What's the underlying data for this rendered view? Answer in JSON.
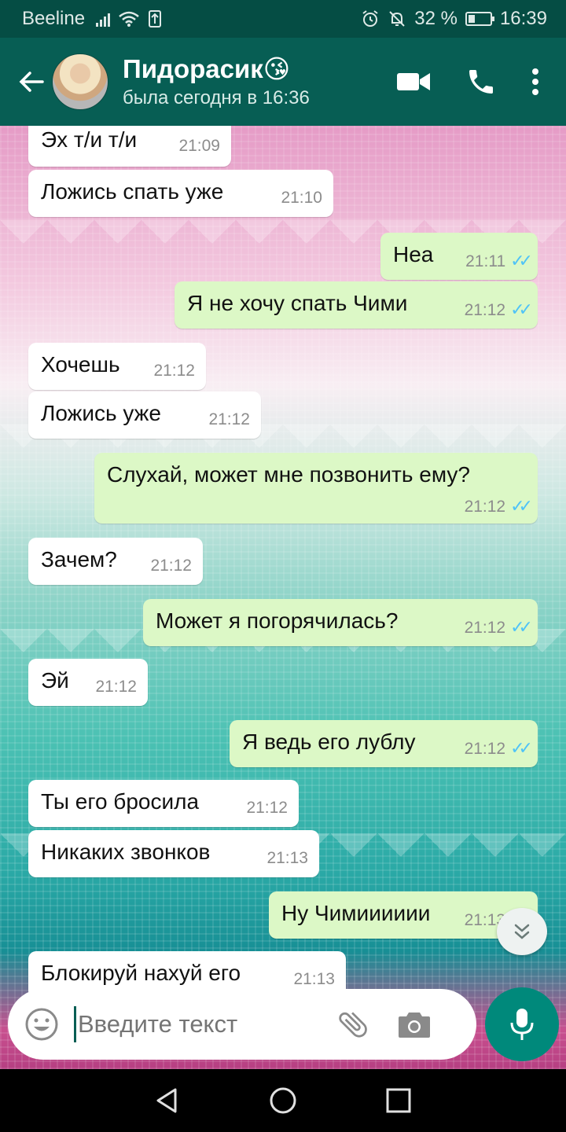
{
  "status_bar": {
    "carrier": "Beeline",
    "battery": "32 %",
    "battery_level": 0.32,
    "time": "16:39"
  },
  "header": {
    "contact_name": "Пидорасик😘",
    "last_seen": "была сегодня в 16:36",
    "icons": [
      "back-arrow-icon",
      "video-call-icon",
      "phone-icon",
      "more-vert-icon"
    ]
  },
  "messages": [
    {
      "dir": "in",
      "text": "Эх т/и т/и",
      "time": "21:09"
    },
    {
      "dir": "in",
      "text": "Ложись спать уже",
      "time": "21:10"
    },
    {
      "dir": "out",
      "text": "Неа",
      "time": "21:11"
    },
    {
      "dir": "out",
      "text": "Я не хочу спать Чими",
      "time": "21:12"
    },
    {
      "dir": "in",
      "text": "Хочешь",
      "time": "21:12"
    },
    {
      "dir": "in",
      "text": "Ложись уже",
      "time": "21:12"
    },
    {
      "dir": "out",
      "text": "Слухай, может мне позвонить ему?",
      "time": "21:12"
    },
    {
      "dir": "in",
      "text": "Зачем?",
      "time": "21:12"
    },
    {
      "dir": "out",
      "text": "Может я погорячилась?",
      "time": "21:12"
    },
    {
      "dir": "in",
      "text": "Эй",
      "time": "21:12"
    },
    {
      "dir": "out",
      "text": "Я ведь его лублу",
      "time": "21:12"
    },
    {
      "dir": "in",
      "text": "Ты его бросила",
      "time": "21:12"
    },
    {
      "dir": "in",
      "text": "Никаких звонков",
      "time": "21:13"
    },
    {
      "dir": "out",
      "text": "Ну Чимииииии",
      "time": "21:13"
    },
    {
      "dir": "in",
      "text": "Блокируй нахуй его",
      "time": "21:13"
    }
  ],
  "composer": {
    "placeholder": "Введите текст",
    "icons": [
      "emoji-icon",
      "attach-icon",
      "camera-icon",
      "mic-icon"
    ]
  },
  "colors": {
    "header": "#075e54",
    "status_bar": "#054d44",
    "outgoing_bubble": "#dcf8c6",
    "incoming_bubble": "#ffffff",
    "read_ticks": "#4fc3f7",
    "mic_button": "#00897b"
  }
}
